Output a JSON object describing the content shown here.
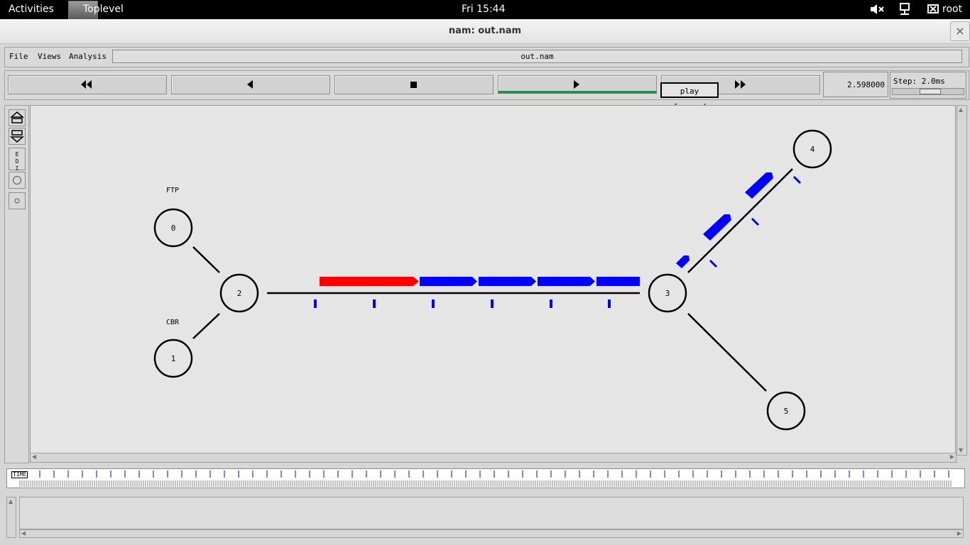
{
  "topbar": {
    "activities": "Activities",
    "app_name": "Toplevel",
    "clock": "Fri 15:44",
    "user": "root"
  },
  "window": {
    "title": "nam: out.nam",
    "close_glyph": "×"
  },
  "menu": {
    "file": "File",
    "views": "Views",
    "analysis": "Analysis",
    "filename": "out.nam"
  },
  "controls": {
    "time_value": "2.598000",
    "step_label": "Step: 2.0ms",
    "tooltip": "play forward",
    "buttons": [
      "rewind-icon",
      "play-backward-icon",
      "stop-icon",
      "play-forward-icon",
      "fast-forward-icon"
    ]
  },
  "tools": {
    "edit_label": "E D I T"
  },
  "topology": {
    "nodes": [
      "0",
      "1",
      "2",
      "3",
      "4",
      "5"
    ],
    "agent_labels": {
      "ftp": "FTP",
      "cbr": "CBR"
    },
    "packet_colors": {
      "ftp_flow": "#ff0000",
      "cbr_flow": "#0000ff"
    }
  },
  "timeline": {
    "label": "TIME"
  }
}
